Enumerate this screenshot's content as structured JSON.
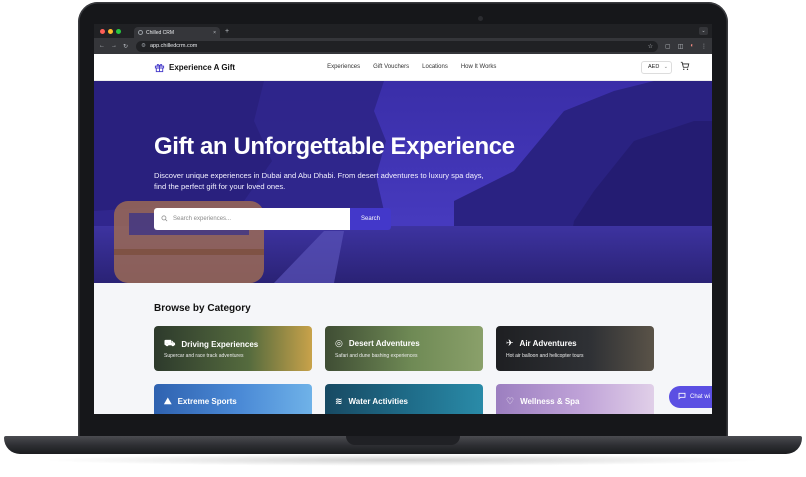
{
  "browser": {
    "tab_title": "Chilled CRM",
    "tab_close": "×",
    "new_tab": "+",
    "url": "app.chilledcrm.com"
  },
  "site": {
    "brand": "Experience A Gift",
    "nav": [
      "Experiences",
      "Gift Vouchers",
      "Locations",
      "How It Works"
    ],
    "currency": "AED"
  },
  "hero": {
    "title": "Gift an Unforgettable Experience",
    "subtitle": "Discover unique experiences in Dubai and Abu Dhabi. From desert adventures to luxury spa days, find the perfect gift for your loved ones.",
    "search_placeholder": "Search experiences...",
    "search_button": "Search"
  },
  "categories": {
    "heading": "Browse by Category",
    "items": [
      {
        "title": "Driving Experiences",
        "desc": "Supercar and race track adventures",
        "icon": "car-icon",
        "color": "#3b4a34"
      },
      {
        "title": "Desert Adventures",
        "desc": "Safari and dune bashing experiences",
        "icon": "compass-icon",
        "color": "#5a6d48"
      },
      {
        "title": "Air Adventures",
        "desc": "Hot air balloon and helicopter tours",
        "icon": "plane-icon",
        "color": "#2b2d30"
      },
      {
        "title": "Extreme Sports",
        "desc": "",
        "icon": "mountain-icon",
        "color": "#3d78c4"
      },
      {
        "title": "Water Activities",
        "desc": "",
        "icon": "waves-icon",
        "color": "#1f6d8a"
      },
      {
        "title": "Wellness & Spa",
        "desc": "",
        "icon": "heart-icon",
        "color": "#b79ad0"
      }
    ]
  },
  "chat": {
    "label": "Chat wi"
  }
}
